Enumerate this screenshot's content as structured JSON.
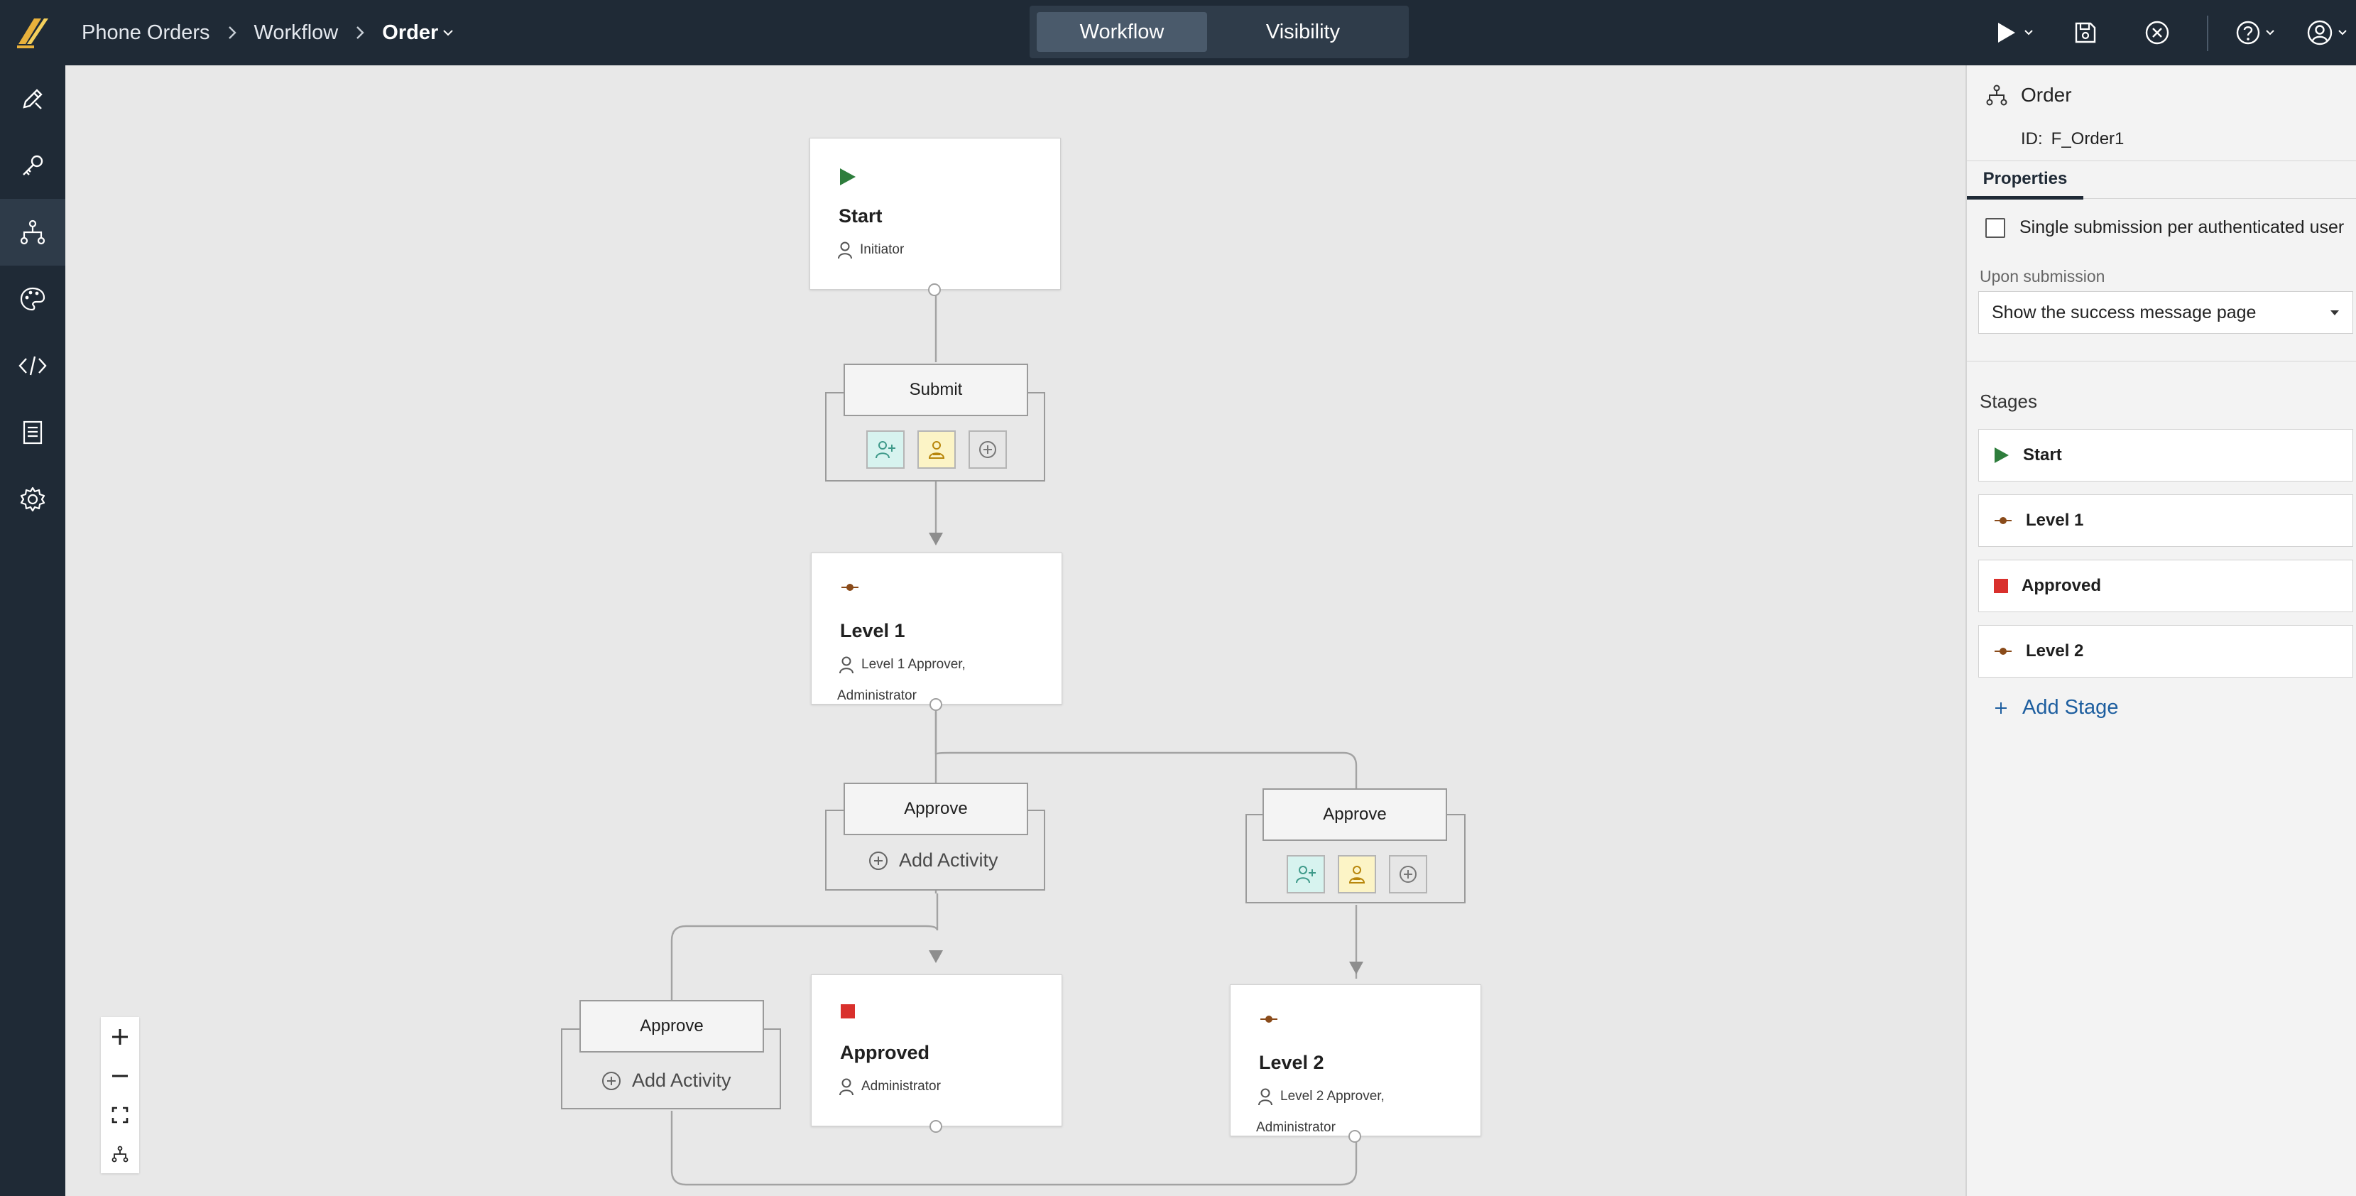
{
  "breadcrumb": {
    "items": [
      "Phone Orders",
      "Workflow"
    ],
    "current": "Order"
  },
  "view_toggle": {
    "workflow": "Workflow",
    "visibility": "Visibility",
    "selected": "Workflow"
  },
  "canvas": {
    "stages": [
      {
        "title": "Start",
        "icon": "play-icon",
        "assignee": "Initiator",
        "assignee_extra": ""
      },
      {
        "title": "Level 1",
        "icon": "stage-dot-icon",
        "assignee": "Level 1 Approver,",
        "assignee_extra": "Administrator"
      },
      {
        "title": "Approved",
        "icon": "stop-square-icon",
        "assignee": "Administrator",
        "assignee_extra": ""
      },
      {
        "title": "Level 2",
        "icon": "stage-dot-icon",
        "assignee": "Level 2 Approver,",
        "assignee_extra": "Administrator"
      }
    ],
    "activities": [
      {
        "label": "Submit"
      },
      {
        "label": "Approve",
        "add_label": "Add Activity"
      },
      {
        "label": "Approve"
      },
      {
        "label": "Approve",
        "add_label": "Add Activity"
      }
    ]
  },
  "panel": {
    "title": "Order",
    "id_label": "ID:",
    "id_value": "F_Order1",
    "tab": "Properties",
    "single_submission": "Single submission per authenticated user",
    "single_submission_checked": false,
    "upon_submission_label": "Upon submission",
    "upon_submission_value": "Show the success message page",
    "stages_label": "Stages",
    "stages": [
      {
        "name": "Start",
        "icon": "play-icon"
      },
      {
        "name": "Level 1",
        "icon": "stage-dot-icon"
      },
      {
        "name": "Approved",
        "icon": "stop-square-icon"
      },
      {
        "name": "Level 2",
        "icon": "stage-dot-icon"
      }
    ],
    "add_stage": "Add Stage"
  },
  "colors": {
    "topbar": "#1f2a36",
    "start_green": "#2e7d3c",
    "stop_red": "#d9302c",
    "level_brown": "#8a4b1a",
    "link_blue": "#1d5e9f"
  }
}
